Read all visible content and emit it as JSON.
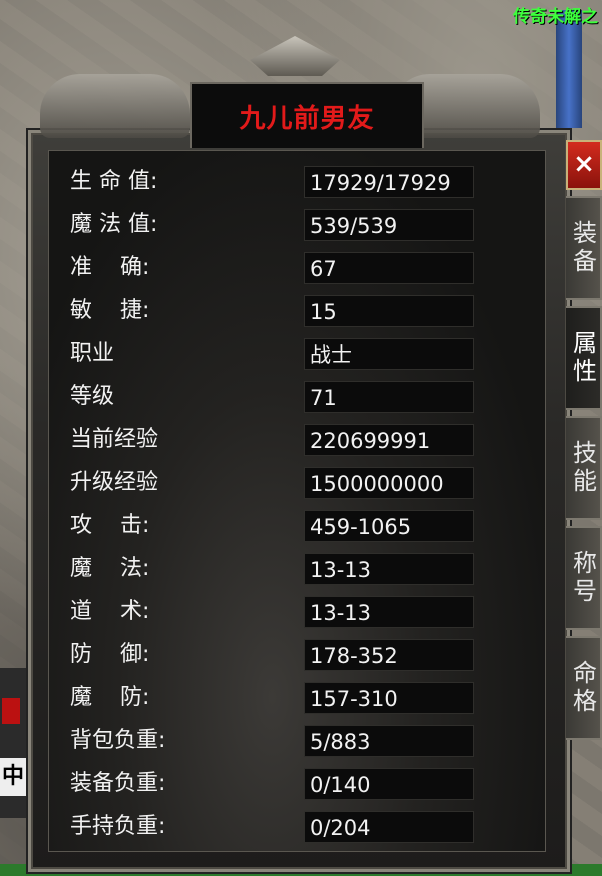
{
  "top_banner": "传奇未解之",
  "side_sign_char": "中",
  "panel": {
    "title": "九儿前男友",
    "stats": [
      {
        "label": "生 命 值:",
        "value": "17929/17929"
      },
      {
        "label": "魔 法 值:",
        "value": "539/539"
      },
      {
        "label": "准    确:",
        "value": "67"
      },
      {
        "label": "敏    捷:",
        "value": "15"
      },
      {
        "label": "职业",
        "value": "战士"
      },
      {
        "label": "等级",
        "value": "71"
      },
      {
        "label": "当前经验",
        "value": "220699991"
      },
      {
        "label": "升级经验",
        "value": "1500000000"
      },
      {
        "label": "攻    击:",
        "value": "459-1065"
      },
      {
        "label": "魔    法:",
        "value": "13-13"
      },
      {
        "label": "道    术:",
        "value": "13-13"
      },
      {
        "label": "防    御:",
        "value": "178-352"
      },
      {
        "label": "魔    防:",
        "value": "157-310"
      },
      {
        "label": "背包负重:",
        "value": "5/883"
      },
      {
        "label": "装备负重:",
        "value": "0/140"
      },
      {
        "label": "手持负重:",
        "value": "0/204"
      }
    ]
  },
  "close_button": "×",
  "tabs": [
    {
      "label": "装备",
      "active": false
    },
    {
      "label": "属性",
      "active": true
    },
    {
      "label": "技能",
      "active": false
    },
    {
      "label": "称号",
      "active": false
    },
    {
      "label": "命格",
      "active": false
    }
  ],
  "colors": {
    "title": "#e21a1a",
    "banner": "#3cff3c",
    "close": "#d32b1e"
  }
}
